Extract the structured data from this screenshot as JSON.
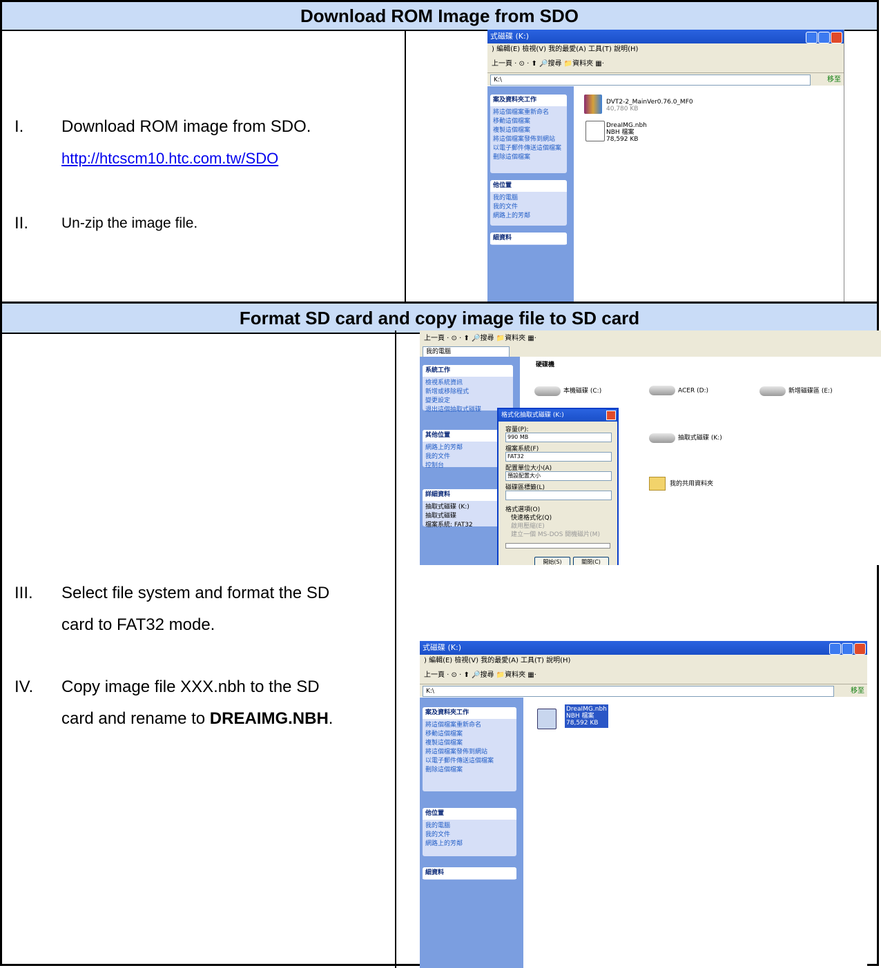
{
  "section1": {
    "title": "Download ROM Image from SDO",
    "step1": {
      "num": "I.",
      "text": "Download ROM image from SDO.",
      "link": "http://htcscm10.htc.com.tw/SDO"
    },
    "step2": {
      "num": "II.",
      "text": "Un-zip the image file."
    }
  },
  "section2": {
    "title": "Format SD card and copy image file to SD card",
    "step3": {
      "num": "III.",
      "line1": "Select file system and format the SD",
      "line2": "card to FAT32 mode."
    },
    "step4": {
      "num": "IV.",
      "line1": "Copy image file XXX.nbh to the SD",
      "line2_pre": "card and rename to ",
      "line2_bold": "DREAIMG.NBH",
      "line2_post": "."
    }
  },
  "shot1": {
    "title": "式磁碟 (K:)",
    "menu": ") 編輯(E)  檢視(V)  我的最愛(A)  工具(T)  說明(H)",
    "toolbar": "上一頁 · ⊙ · ⬆ 🔎搜尋 📁資料夾 ▦·",
    "address": "K:\\",
    "go": "移至",
    "panel1_title": "案及資料夾工作",
    "panel1_items": [
      "將這個檔案重新命名",
      "移動這個檔案",
      "複製這個檔案",
      "將這個檔案發佈到網站",
      "以電子郵件傳送這個檔案",
      "刪除這個檔案"
    ],
    "panel2_title": "他位置",
    "panel2_items": [
      "我的電腦",
      "我的文件",
      "網路上的芳鄰"
    ],
    "panel3_title": "細資料",
    "file1": {
      "name": "DVT2-2_MainVer0.76.0_MF0",
      "size": "40,780 KB"
    },
    "file2": {
      "name": "DreaIMG.nbh",
      "type": "NBH 檔案",
      "size": "78,592 KB"
    }
  },
  "shot2": {
    "toolbar": "上一頁 · ⊙ · ⬆ 🔎搜尋 📁資料夾 ▦·",
    "address": "我的電腦",
    "panel1_title": "系統工作",
    "panel1_items": [
      "檢視系統資訊",
      "新增或移除程式",
      "變更設定",
      "退出這個抽取式磁碟"
    ],
    "panel2_title": "其他位置",
    "panel2_items": [
      "網路上的芳鄰",
      "我的文件",
      "控制台"
    ],
    "panel3_title": "詳細資料",
    "panel3_items": [
      "抽取式磁碟 (K:)",
      "抽取式磁碟",
      "檔案系統: FAT32"
    ],
    "group_title": "硬碟機",
    "drives": [
      "本機磁碟 (C:)",
      "ACER (D:)",
      "新增磁碟區 (E:)",
      "抽取式磁碟 (K:)",
      "我的共用資料夾"
    ],
    "dialog": {
      "title": "格式化抽取式磁碟 (K:)",
      "capacity_label": "容量(P):",
      "capacity": "990 MB",
      "fs_label": "檔案系統(F)",
      "fs": "FAT32",
      "alloc_label": "配置單位大小(A)",
      "alloc": "預設配置大小",
      "vol_label": "磁碟區標籤(L)",
      "opts_label": "格式選項(O)",
      "opt1": "快速格式化(Q)",
      "opt2": "啟用壓縮(E)",
      "opt3": "建立一個 MS-DOS 開機磁片(M)",
      "start": "開始(S)",
      "close": "關閉(C)"
    }
  },
  "shot3": {
    "title": "式磁碟 (K:)",
    "menu": ") 編輯(E)  檢視(V)  我的最愛(A)  工具(T)  說明(H)",
    "toolbar": "上一頁 · ⊙ · ⬆ 🔎搜尋 📁資料夾 ▦·",
    "address": "K:\\",
    "go": "移至",
    "panel1_title": "案及資料夾工作",
    "panel1_items": [
      "將這個檔案重新命名",
      "移動這個檔案",
      "複製這個檔案",
      "將這個檔案發佈到網站",
      "以電子郵件傳送這個檔案",
      "刪除這個檔案"
    ],
    "panel2_title": "他位置",
    "panel2_items": [
      "我的電腦",
      "我的文件",
      "網路上的芳鄰"
    ],
    "panel3_title": "細資料",
    "file": {
      "name": "DreaIMG.nbh",
      "type": "NBH 檔案",
      "size": "78,592 KB"
    }
  }
}
